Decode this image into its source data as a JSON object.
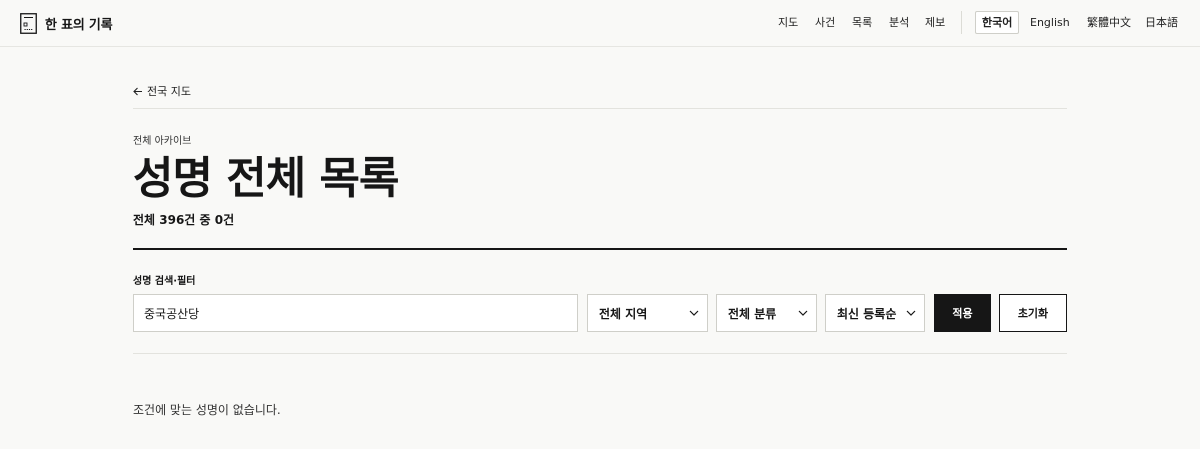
{
  "header": {
    "brand": "한 표의 기록",
    "brand_icon": "ballot-document-icon",
    "nav": [
      "지도",
      "사건",
      "목록",
      "분석",
      "제보"
    ],
    "languages": [
      {
        "label": "한국어",
        "active": true
      },
      {
        "label": "English",
        "active": false
      },
      {
        "label": "繁體中文",
        "active": false
      },
      {
        "label": "日本語",
        "active": false
      }
    ]
  },
  "back_link": {
    "icon": "arrow-left-icon",
    "label": "전국 지도"
  },
  "page": {
    "eyebrow": "전체 아카이브",
    "title": "성명 전체 목록",
    "count": "전체 396건 중 0건"
  },
  "filters": {
    "label": "성명 검색·필터",
    "search_value": "중국공산당",
    "region": "전체 지역",
    "category": "전체 분류",
    "sort": "최신 등록순",
    "apply_label": "적용",
    "reset_label": "초기화"
  },
  "results": {
    "empty_message": "조건에 맞는 성명이 없습니다."
  },
  "colors": {
    "background": "#f9f9f7",
    "ink": "#161616",
    "border": "#cfcfc9"
  }
}
